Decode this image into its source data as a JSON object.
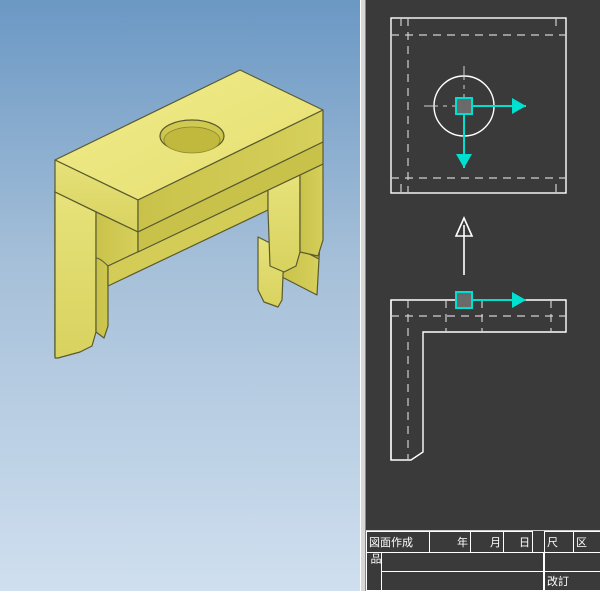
{
  "app": {
    "left_view_kind": "3D isometric model view",
    "right_view_kind": "2D drawing / drafting view",
    "part_description": "Yellow bracket with square top plate, central through-hole, front wall with two legs and a side wall"
  },
  "colors": {
    "model_fill": "#e7e27a",
    "model_shadow": "#cfc95b",
    "model_edge": "#5a5a30",
    "sky_gradient_top": "#6b98c4",
    "sky_gradient_bottom": "#cfdfef",
    "draft_bg": "#3a3a3a",
    "draft_line": "#ffffff",
    "draft_hidden": "#b0b0b0",
    "axis_arrow": "#00e0d0",
    "axis_origin_fill": "#6a6a6a"
  },
  "titleblock": {
    "cell_drawing": "図面作成",
    "cell_year": "年",
    "cell_month": "月",
    "cell_day": "日",
    "cell_scale": "尺",
    "cell_extra_col": "区",
    "cell_part": "品",
    "cell_rev": "改訂"
  },
  "drawing": {
    "has_top_view": true,
    "has_front_view": true,
    "top_view_hole": true,
    "projection_arrows": [
      "right",
      "down",
      "up",
      "right"
    ]
  }
}
